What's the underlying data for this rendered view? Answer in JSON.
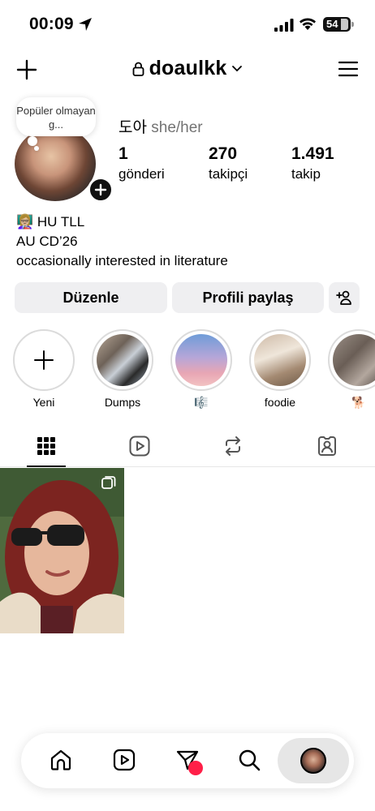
{
  "status_bar": {
    "time": "00:09",
    "battery": "54"
  },
  "header": {
    "username": "doaulkk"
  },
  "profile": {
    "note": "Popüler olmayan g...",
    "display_name": "도아",
    "pronouns": "she/her",
    "stats": [
      {
        "value": "1",
        "label": "gönderi"
      },
      {
        "value": "270",
        "label": "takipçi"
      },
      {
        "value": "1.491",
        "label": "takip"
      }
    ],
    "bio": [
      "👩🏼‍🏫 HU TLL",
      "AU CD’26",
      "occasionally interested in literature"
    ]
  },
  "buttons": {
    "edit": "Düzenle",
    "share": "Profili paylaş"
  },
  "highlights": [
    {
      "label": "Yeni"
    },
    {
      "label": "Dumps"
    },
    {
      "label": "🎼"
    },
    {
      "label": "foodie"
    },
    {
      "label": "🐕"
    }
  ],
  "colors": {
    "notification_dot": "#ff1f48",
    "button_bg": "#efeff1",
    "secondary_text": "#737373"
  },
  "icons": {
    "header": [
      "plus-icon",
      "lock-icon",
      "chevron-down-icon",
      "menu-icon"
    ],
    "tabs": [
      "grid-icon",
      "reels-icon",
      "reposts-icon",
      "tagged-icon"
    ],
    "nav": [
      "home-icon",
      "reels-icon",
      "send-icon",
      "search-icon",
      "profile-avatar"
    ]
  }
}
